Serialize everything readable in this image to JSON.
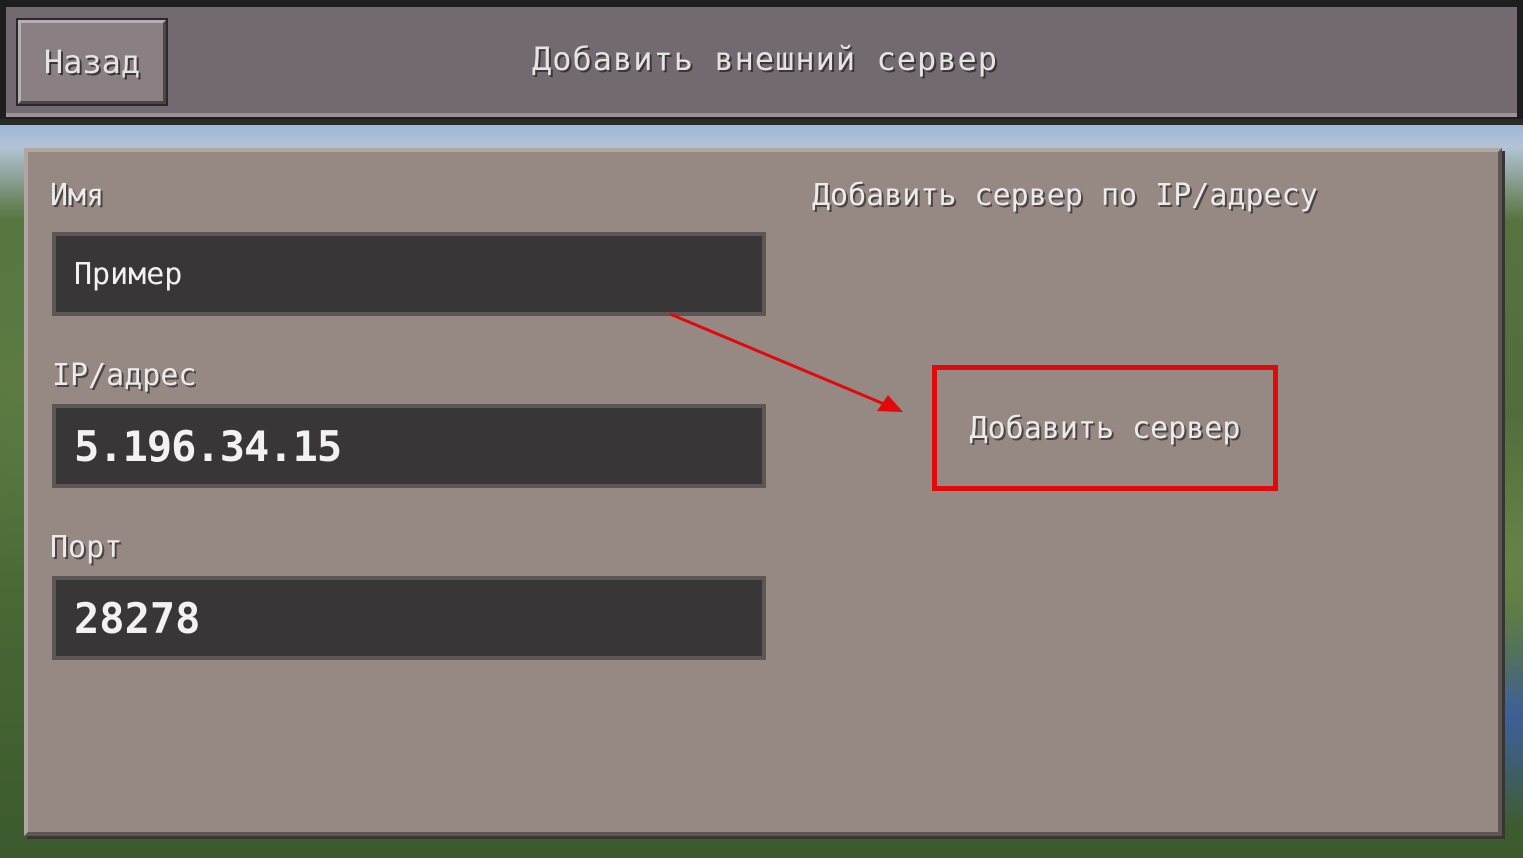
{
  "header": {
    "back_label": "Назад",
    "title": "Добавить внешний сервер"
  },
  "form": {
    "name_label": "Имя",
    "name_value": "Пример",
    "ip_label": "IP/адрес",
    "ip_value": "5.196.34.15",
    "port_label": "Порт",
    "port_value": "28278"
  },
  "right": {
    "section_title": "Добавить сервер по IP/адресу",
    "add_button_label": "Добавить сервер"
  },
  "annotation": {
    "highlight_color": "#e0090b",
    "arrow_color": "#e0090b"
  }
}
